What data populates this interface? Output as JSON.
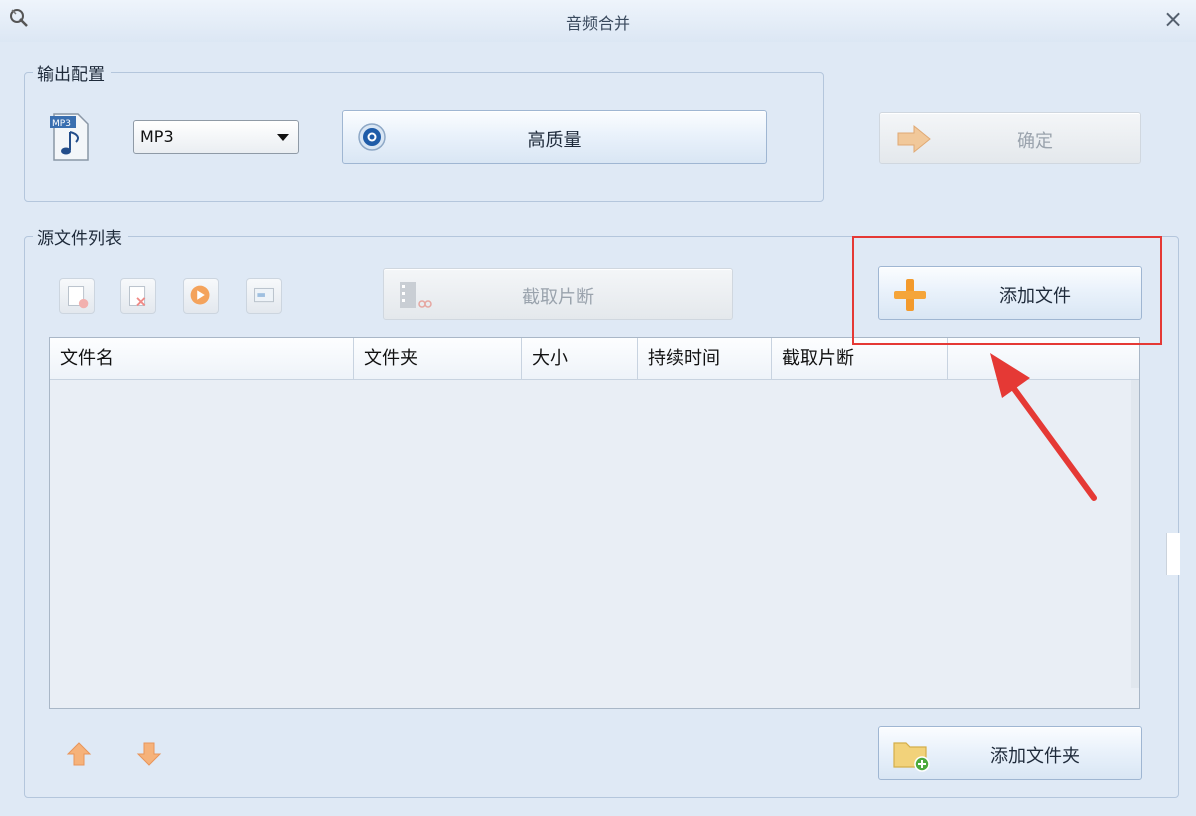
{
  "window": {
    "title": "音频合并",
    "close_glyph": "×"
  },
  "output_config": {
    "legend": "输出配置",
    "format_icon": "mp3-file-icon",
    "format_select": {
      "value": "MP3"
    },
    "quality_button": {
      "label": "高质量",
      "icon": "quality-settings-icon"
    },
    "confirm_button": {
      "label": "确定",
      "icon": "arrow-right-icon",
      "enabled": false
    }
  },
  "source_files": {
    "legend": "源文件列表",
    "toolbar_icons": [
      "remove-file-icon",
      "delete-file-icon",
      "play-icon",
      "properties-icon"
    ],
    "clip_button": {
      "label": "截取片断",
      "icon": "film-scissors-icon",
      "enabled": false
    },
    "add_file_button": {
      "label": "添加文件",
      "icon": "plus-icon"
    },
    "columns": [
      "文件名",
      "文件夹",
      "大小",
      "持续时间",
      "截取片断"
    ],
    "rows": [],
    "move_up_icon": "arrow-up-icon",
    "move_down_icon": "arrow-down-icon",
    "add_folder_button": {
      "label": "添加文件夹",
      "icon": "add-folder-icon"
    }
  },
  "annotation": {
    "highlight_color": "#e53935",
    "arrow_color": "#e53935"
  }
}
